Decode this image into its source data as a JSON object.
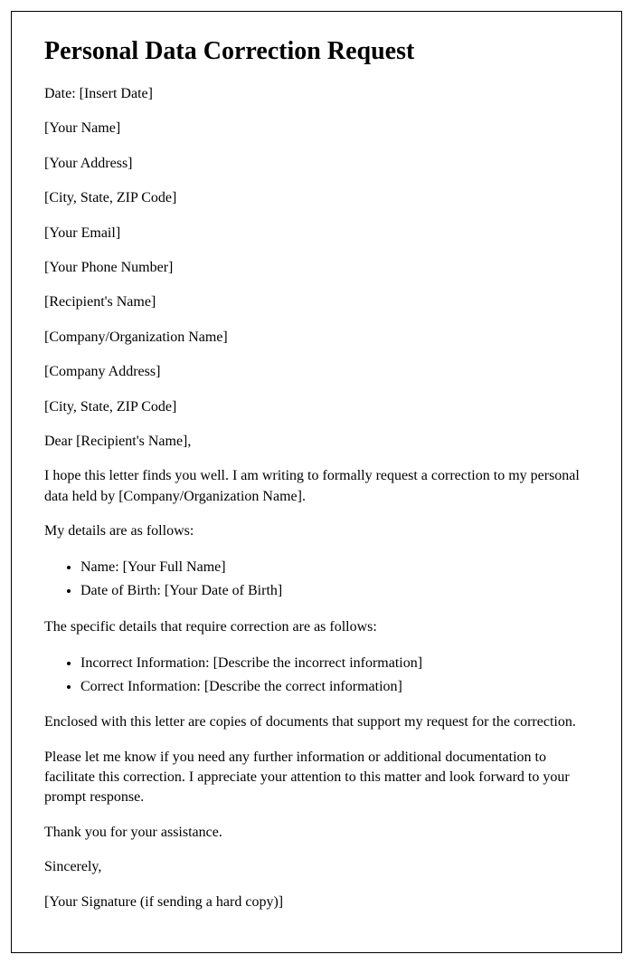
{
  "title": "Personal Data Correction Request",
  "header": {
    "date": "Date: [Insert Date]",
    "your_name": "[Your Name]",
    "your_address": "[Your Address]",
    "your_city": "[City, State, ZIP Code]",
    "your_email": "[Your Email]",
    "your_phone": "[Your Phone Number]",
    "recipient_name": "[Recipient's Name]",
    "company_name": "[Company/Organization Name]",
    "company_address": "[Company Address]",
    "company_city": "[City, State, ZIP Code]"
  },
  "salutation": "Dear [Recipient's Name],",
  "body": {
    "intro": "I hope this letter finds you well. I am writing to formally request a correction to my personal data held by [Company/Organization Name].",
    "details_intro": "My details are as follows:",
    "details": {
      "name": "Name: [Your Full Name]",
      "dob": "Date of Birth: [Your Date of Birth]"
    },
    "correction_intro": "The specific details that require correction are as follows:",
    "corrections": {
      "incorrect": "Incorrect Information: [Describe the incorrect information]",
      "correct": "Correct Information: [Describe the correct information]"
    },
    "enclosure": "Enclosed with this letter are copies of documents that support my request for the correction.",
    "followup": "Please let me know if you need any further information or additional documentation to facilitate this correction. I appreciate your attention to this matter and look forward to your prompt response.",
    "thanks": "Thank you for your assistance."
  },
  "closing": {
    "sincerely": "Sincerely,",
    "signature": "[Your Signature (if sending a hard copy)]"
  }
}
